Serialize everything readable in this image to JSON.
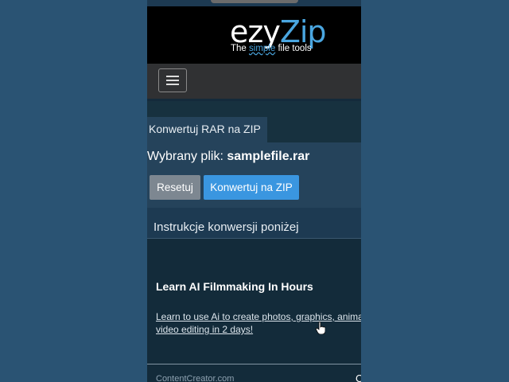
{
  "logo": {
    "word_part1": "ezy",
    "word_part2": "Zip",
    "tagline_before": "The ",
    "tagline_highlight": "simple",
    "tagline_after": " file tools"
  },
  "navbar": {
    "menu_icon": "hamburger-menu-icon"
  },
  "tab": {
    "label": "Konwertuj RAR na ZIP"
  },
  "file": {
    "label": "Wybrany plik: ",
    "name": "samplefile.rar"
  },
  "buttons": {
    "reset_label": "Resetuj",
    "convert_label": "Konwertuj na ZIP"
  },
  "instructions": {
    "heading": "Instrukcje konwersji poniżej"
  },
  "ad": {
    "title": "Learn AI Filmmaking In Hours",
    "body_line1": "Learn to use Ai to create photos, graphics, animati",
    "body_line2": "video editing in 2 days!",
    "source": "ContentCreator.com",
    "extra": "C"
  },
  "colors": {
    "page_bg": "#2a5373",
    "accent": "#3a96e0",
    "logo_blue": "#4aa6e0"
  }
}
